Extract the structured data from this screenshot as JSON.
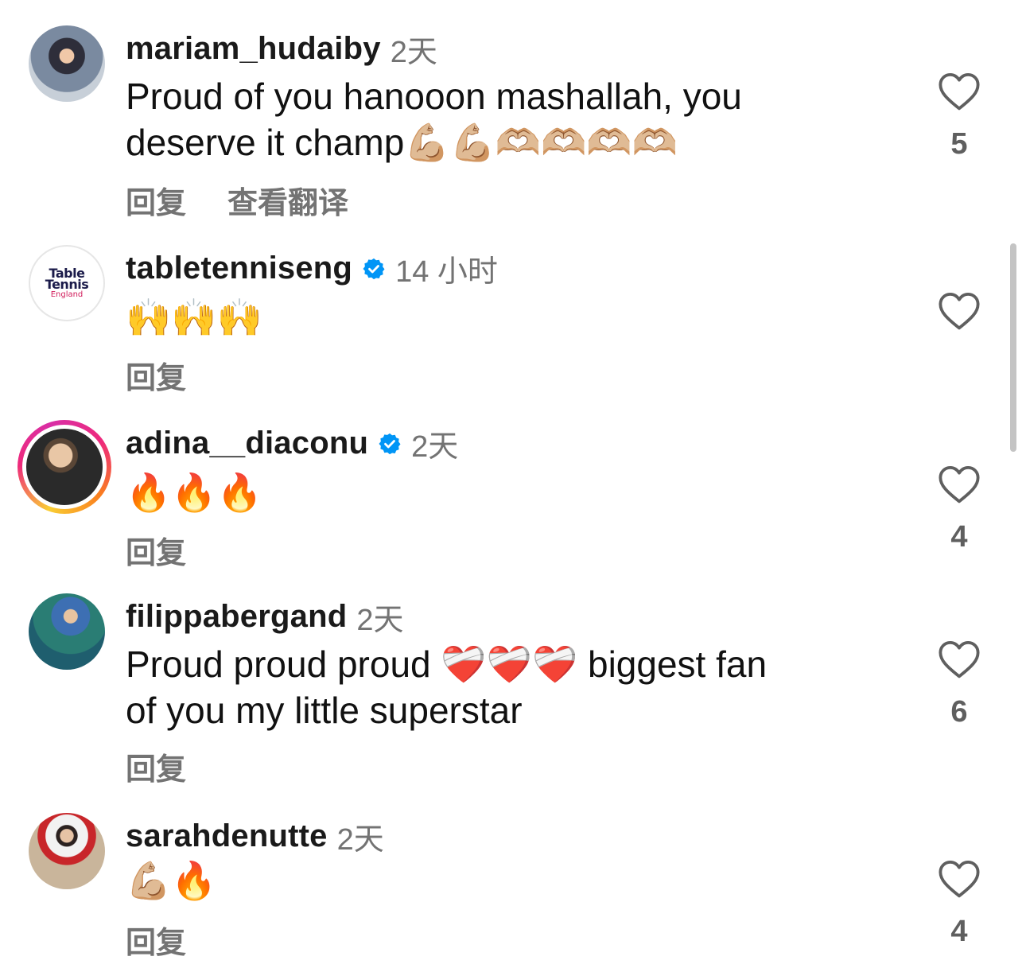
{
  "comments": [
    {
      "username": "mariam_hudaiby",
      "verified": false,
      "time": "2天",
      "text_line1": "Proud of you hanooon mashallah, you",
      "text_line2": "deserve it champ💪🏼💪🏼🫶🏼🫶🏼🫶🏼🫶🏼",
      "reply": "回复",
      "translate": "查看翻译",
      "likes": "5",
      "avatar": "player-photo"
    },
    {
      "username": "tabletenniseng",
      "verified": true,
      "time": "14 小时",
      "text_line1": "🙌🙌🙌",
      "reply": "回复",
      "likes": "",
      "avatar_logo_line1": "Table",
      "avatar_logo_line2": "Tennis",
      "avatar_logo_line3": "England"
    },
    {
      "username": "adina__diaconu",
      "verified": true,
      "time": "2天",
      "text_line1": "🔥🔥🔥",
      "reply": "回复",
      "likes": "4",
      "avatar": "story-ring-photo"
    },
    {
      "username": "filippabergand",
      "verified": false,
      "time": "2天",
      "text_line1": "Proud proud proud ❤️‍🩹❤️‍🩹❤️‍🩹 biggest fan",
      "text_line2": "of you my little superstar",
      "reply": "回复",
      "likes": "6",
      "avatar": "player-photo"
    },
    {
      "username": "sarahdenutte",
      "verified": false,
      "time": "2天",
      "text_line1": "💪🏼🔥",
      "reply": "回复",
      "likes": "4",
      "avatar": "portrait-photo"
    }
  ],
  "colors": {
    "verified_blue": "#0095f6",
    "secondary_text": "#737373",
    "primary_text": "#111111"
  },
  "icons": {
    "like": "heart-outline-icon",
    "verified": "verified-badge-icon"
  }
}
